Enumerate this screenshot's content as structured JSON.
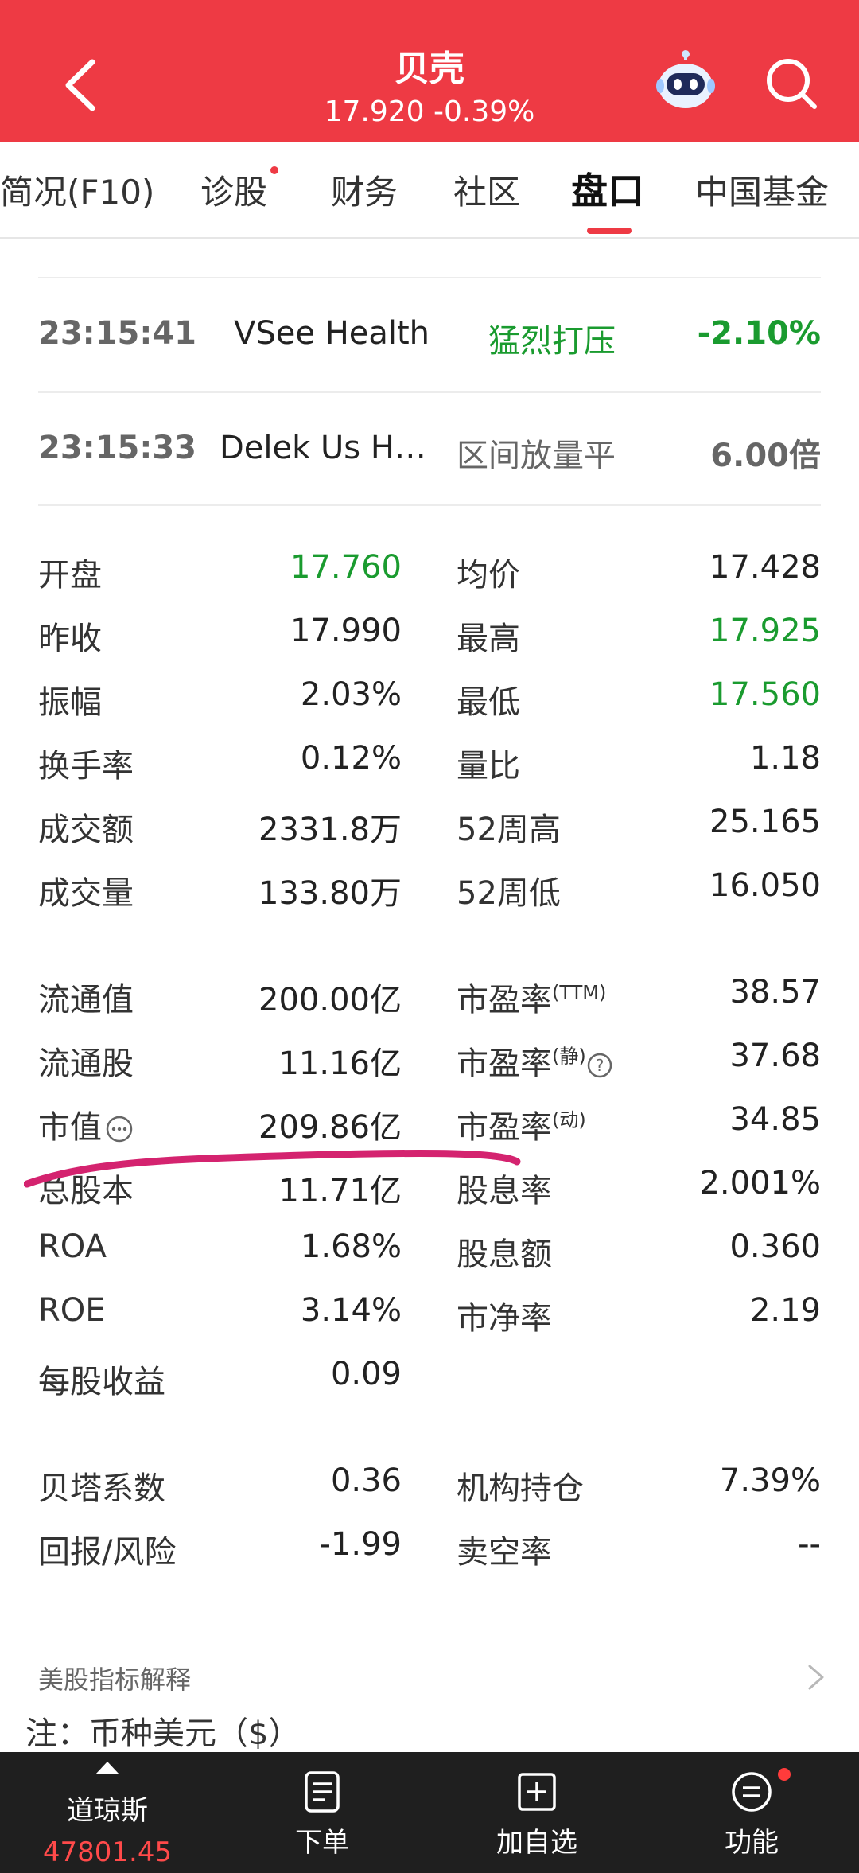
{
  "header": {
    "title": "贝壳",
    "price_line": "17.920 -0.39%",
    "icons": {
      "back": "chevron-left-icon",
      "assistant": "robot-icon",
      "search": "search-icon"
    }
  },
  "tabs": [
    {
      "label": "简况(F10)"
    },
    {
      "label": "诊股",
      "badge": true
    },
    {
      "label": "财务"
    },
    {
      "label": "社区"
    },
    {
      "label": "盘口",
      "active": true
    },
    {
      "label": "中国基金"
    }
  ],
  "feed": [
    {
      "time": "23:15:41",
      "name": "VSee Health",
      "signal": "猛烈打压",
      "value": "-2.10%"
    },
    {
      "time": "23:15:33",
      "name": "Delek Us H…",
      "signal": "区间放量平",
      "value": "6.00倍"
    }
  ],
  "quotes": {
    "left": [
      {
        "label": "开盘",
        "value": "17.760",
        "color": "#1a9b2f"
      },
      {
        "label": "昨收",
        "value": "17.990"
      },
      {
        "label": "振幅",
        "value": "2.03%"
      },
      {
        "label": "换手率",
        "value": "0.12%"
      },
      {
        "label": "成交额",
        "value": "2331.8万"
      },
      {
        "label": "成交量",
        "value": "133.80万"
      }
    ],
    "right": [
      {
        "label": "均价",
        "value": "17.428"
      },
      {
        "label": "最高",
        "value": "17.925",
        "color": "#1a9b2f"
      },
      {
        "label": "最低",
        "value": "17.560",
        "color": "#1a9b2f"
      },
      {
        "label": "量比",
        "value": "1.18"
      },
      {
        "label": "52周高",
        "value": "25.165"
      },
      {
        "label": "52周低",
        "value": "16.050"
      }
    ]
  },
  "valuation": {
    "left": [
      {
        "label": "流通值",
        "value": "200.00亿"
      },
      {
        "label": "流通股",
        "value": "11.16亿"
      },
      {
        "label": "市值",
        "value": "209.86亿",
        "icon": "more-icon"
      },
      {
        "label": "总股本",
        "value": "11.71亿"
      },
      {
        "label": "ROA",
        "value": "1.68%"
      },
      {
        "label": "ROE",
        "value": "3.14%"
      },
      {
        "label": "每股收益",
        "value": "0.09"
      }
    ],
    "right": [
      {
        "label": "市盈率",
        "sup": "(TTM)",
        "value": "38.57"
      },
      {
        "label": "市盈率",
        "sup": "(静)",
        "value": "37.68",
        "icon": "help-icon"
      },
      {
        "label": "市盈率",
        "sup": "(动)",
        "value": "34.85"
      },
      {
        "label": "股息率",
        "value": "2.001%"
      },
      {
        "label": "股息额",
        "value": "0.360"
      },
      {
        "label": "市净率",
        "value": "2.19"
      }
    ]
  },
  "risk": {
    "left": [
      {
        "label": "贝塔系数",
        "value": "0.36"
      },
      {
        "label": "回报/风险",
        "value": "-1.99"
      }
    ],
    "right": [
      {
        "label": "机构持仓",
        "value": "7.39%"
      },
      {
        "label": "卖空率",
        "value": "--"
      }
    ]
  },
  "footer": {
    "explain_link": "美股指标解释",
    "note": "注：币种美元（$）"
  },
  "bottom_bar": {
    "index_name": "道琼斯",
    "index_value": "47801.45",
    "order": "下单",
    "add_watch": "加自选",
    "functions": "功能"
  },
  "colors": {
    "brand": "#ee3a44",
    "down": "#1a9b2f",
    "annotation": "#d4236f"
  }
}
